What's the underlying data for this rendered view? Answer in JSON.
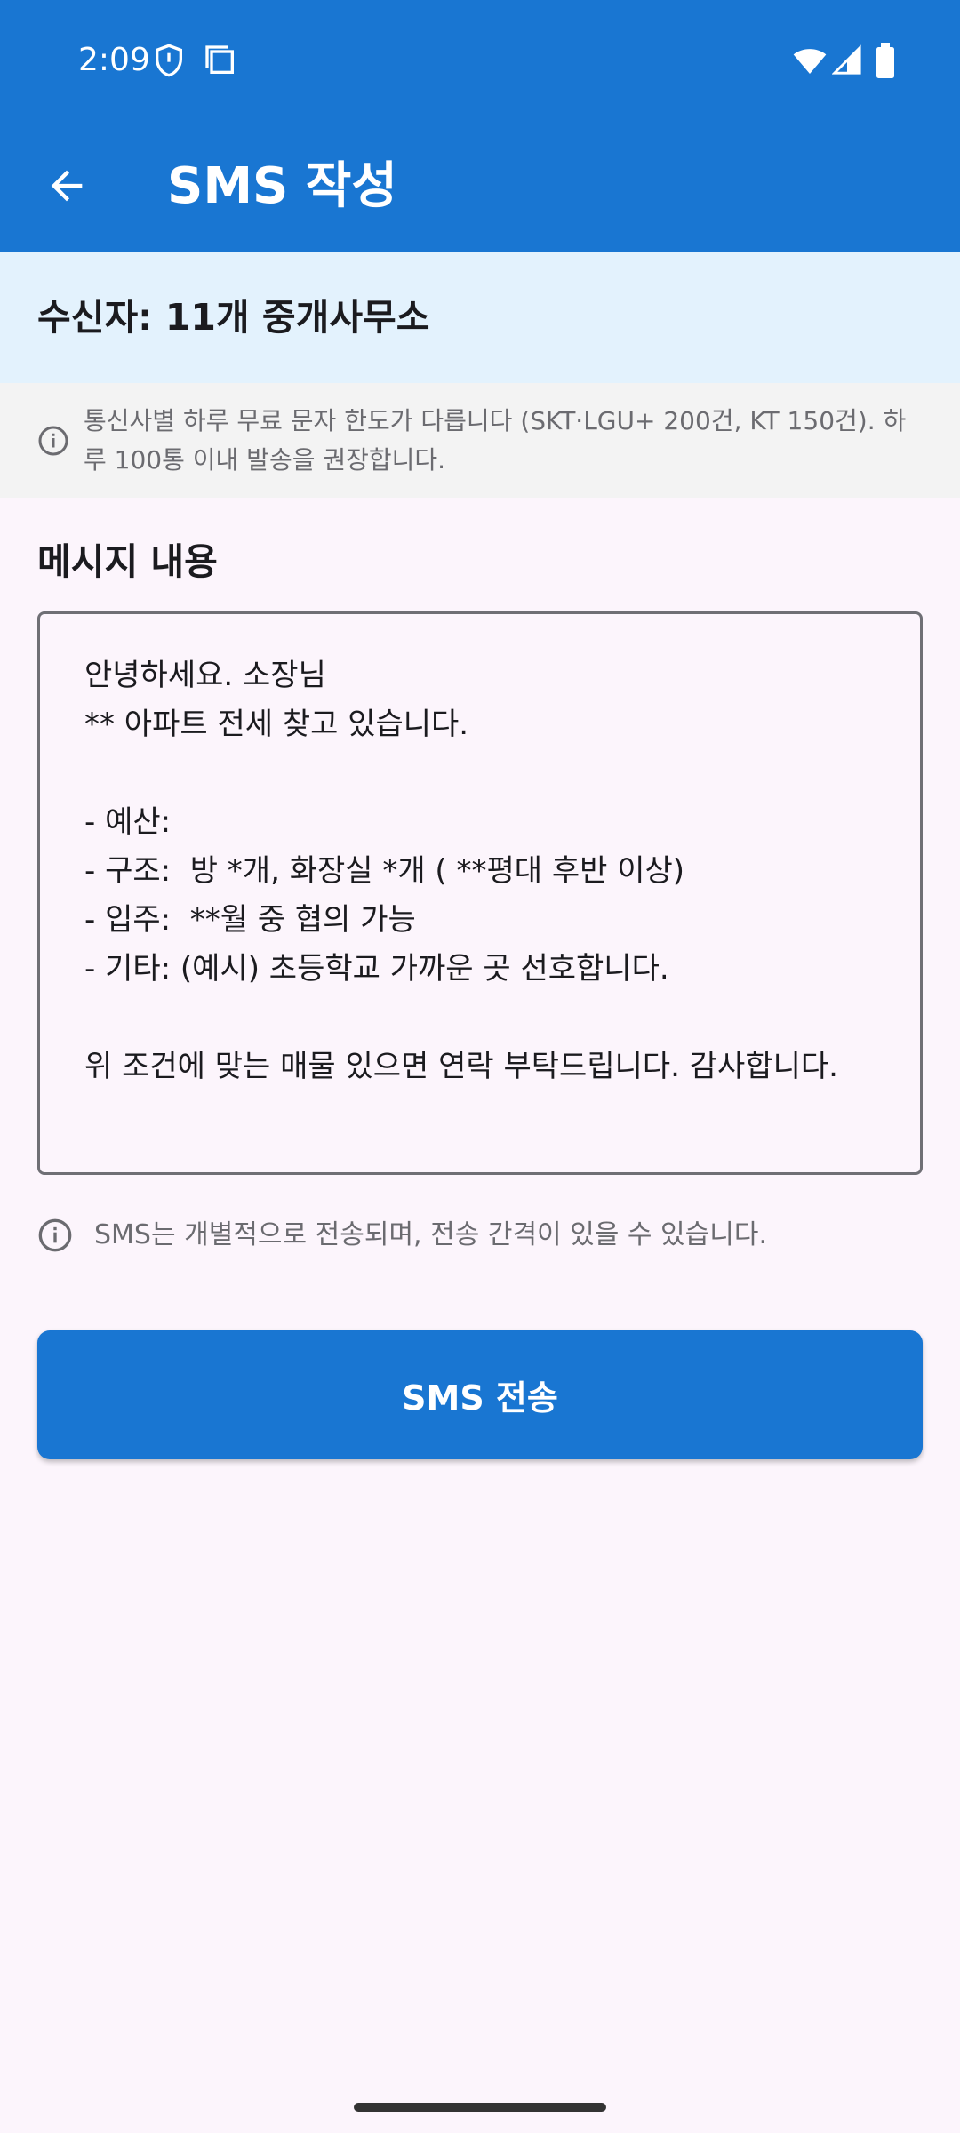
{
  "status_bar": {
    "time": "2:09",
    "icons": [
      "shield-icon",
      "screenshot-icon",
      "wifi-icon",
      "signal-icon",
      "battery-icon"
    ]
  },
  "app_bar": {
    "back_icon": "arrow-back-icon",
    "title": "SMS 작성",
    "color": "#1976D2"
  },
  "recipient": {
    "label": "수신자: 11개 중개사무소",
    "background": "#E3F2FD"
  },
  "notice": {
    "icon": "info-icon",
    "text": "통신사별 하루 무료 문자 한도가 다릅니다 (SKT·LGU+ 200건, KT 150건). 하루 100통 이내 발송을 권장합니다."
  },
  "message": {
    "section_title": "메시지 내용",
    "body": "안녕하세요. 소장님\n** 아파트 전세 찾고 있습니다.\n\n- 예산:\n- 구조:  방 *개, 화장실 *개 ( **평대 후반 이상)\n- 입주:  **월 중 협의 가능\n- 기타: (예시) 초등학교 가까운 곳 선호합니다.\n\n위 조건에 맞는 매물 있으면 연락 부탁드립니다. 감사합니다."
  },
  "hint": {
    "icon": "info-icon",
    "text": "SMS는 개별적으로 전송되며, 전송 간격이 있을 수 있습니다."
  },
  "send_button": {
    "label": "SMS 전송",
    "color": "#1976D2"
  }
}
